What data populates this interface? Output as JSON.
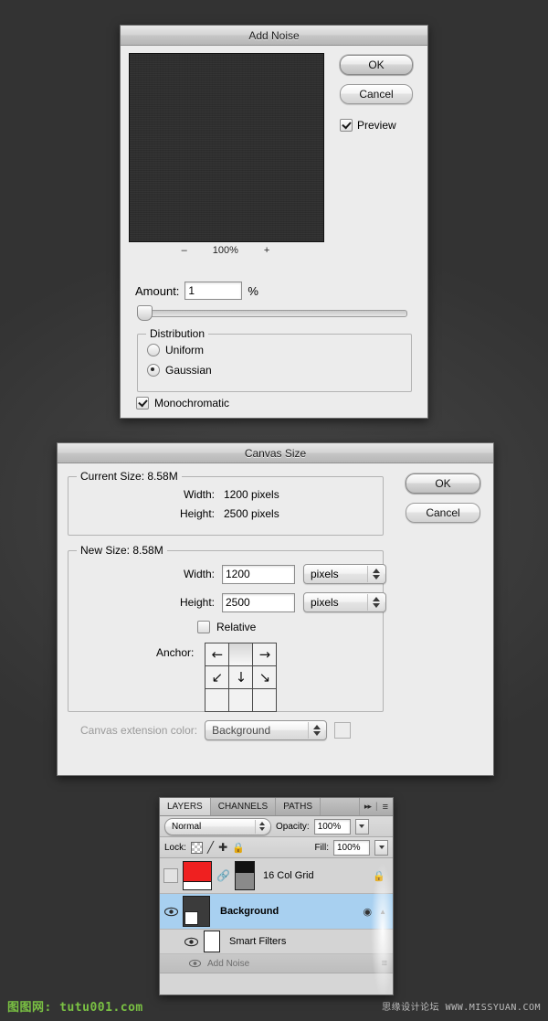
{
  "add_noise": {
    "title": "Add Noise",
    "buttons": {
      "ok": "OK",
      "cancel": "Cancel"
    },
    "preview_checkbox": {
      "label": "Preview",
      "checked": true
    },
    "zoom": {
      "minus": "–",
      "level": "100%",
      "plus": "+"
    },
    "amount": {
      "label": "Amount:",
      "value": "1",
      "unit": "%"
    },
    "distribution": {
      "label": "Distribution",
      "options": [
        {
          "label": "Uniform",
          "selected": false
        },
        {
          "label": "Gaussian",
          "selected": true
        }
      ]
    },
    "monochromatic": {
      "label": "Monochromatic",
      "checked": true
    }
  },
  "canvas_size": {
    "title": "Canvas Size",
    "buttons": {
      "ok": "OK",
      "cancel": "Cancel"
    },
    "current_size": {
      "label": "Current Size: 8.58M",
      "rows": [
        {
          "label": "Width:",
          "value": "1200 pixels"
        },
        {
          "label": "Height:",
          "value": "2500 pixels"
        }
      ]
    },
    "new_size": {
      "label": "New Size: 8.58M",
      "width": {
        "label": "Width:",
        "value": "1200",
        "unit": "pixels"
      },
      "height": {
        "label": "Height:",
        "value": "2500",
        "unit": "pixels"
      },
      "relative": {
        "label": "Relative",
        "checked": false
      }
    },
    "anchor": {
      "label": "Anchor:",
      "cells": [
        {
          "glyph": "←",
          "selected": false
        },
        {
          "glyph": "",
          "selected": true
        },
        {
          "glyph": "→",
          "selected": false
        },
        {
          "glyph": "↙",
          "selected": false
        },
        {
          "glyph": "↓",
          "selected": false
        },
        {
          "glyph": "↘",
          "selected": false
        },
        {
          "glyph": "",
          "selected": false
        },
        {
          "glyph": "",
          "selected": false
        },
        {
          "glyph": "",
          "selected": false
        }
      ]
    },
    "extension": {
      "label": "Canvas extension color:",
      "value": "Background",
      "swatch_color": "#ffffff"
    }
  },
  "layers_panel": {
    "tabs": [
      {
        "label": "LAYERS",
        "active": true
      },
      {
        "label": "CHANNELS",
        "active": false
      },
      {
        "label": "PATHS",
        "active": false
      }
    ],
    "collapse_icon": "▸▸",
    "menu_icon": "≡",
    "blend_mode": {
      "value": "Normal"
    },
    "opacity": {
      "label": "Opacity:",
      "value": "100%"
    },
    "lock": {
      "label": "Lock:",
      "icons": [
        "transparency-lock",
        "brush-lock",
        "move-lock",
        "all-lock"
      ]
    },
    "fill": {
      "label": "Fill:",
      "value": "100%"
    },
    "layers": [
      {
        "name": "16 Col Grid",
        "visible": false,
        "selected": false,
        "locked": true,
        "thumb_color": "#ef2020",
        "has_mask": true
      },
      {
        "name": "Background",
        "visible": true,
        "selected": true,
        "locked": false,
        "thumb_color": "#3b3b3b",
        "smart_object": true
      }
    ],
    "smart_filters": {
      "label": "Smart Filters",
      "visible": true,
      "effects": [
        {
          "label": "Add Noise",
          "visible": true
        }
      ]
    }
  },
  "watermarks": {
    "left": "图图网: tutu001.com",
    "right_cn": "思缘设计论坛",
    "right_url": "WWW.MISSYUAN.COM"
  }
}
